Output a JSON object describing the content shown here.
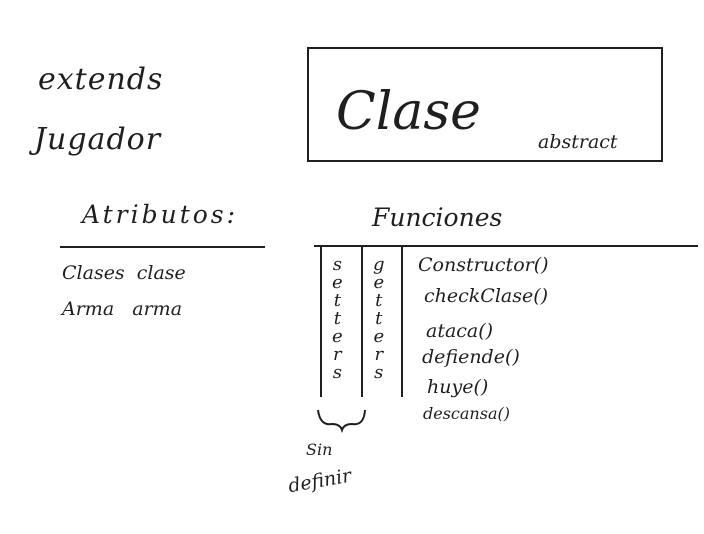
{
  "extends": {
    "keyword": "extends",
    "parent": "Jugador"
  },
  "class_box": {
    "name": "Clase",
    "modifier": "abstract"
  },
  "attributes": {
    "heading": "Atributos:",
    "items": [
      "Clases  clase",
      "Arma   arma"
    ]
  },
  "functions": {
    "heading": "Funciones",
    "setters": "setters",
    "getters": "getters",
    "methods": [
      "Constructor()",
      "checkClase()",
      "ataca()",
      "defiende()",
      "huye()",
      "descansa()"
    ]
  },
  "note": {
    "line1": "Sin",
    "line2": "definir"
  }
}
